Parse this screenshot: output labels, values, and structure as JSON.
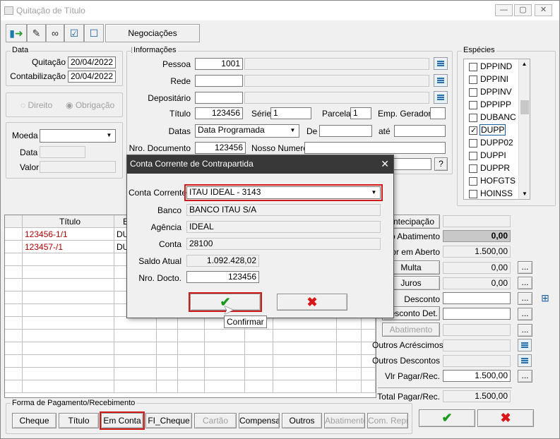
{
  "window": {
    "title": "Quitação de Título"
  },
  "toolbar": {
    "finalizadas": "Negociações Finalizadas"
  },
  "data_section": {
    "legend": "Data",
    "quitacao_label": "Quitação",
    "quitacao_value": "20/04/2022",
    "contab_label": "Contabilização",
    "contab_value": "20/04/2022"
  },
  "radio": {
    "direito": "Direito",
    "obrigacao": "Obrigação"
  },
  "moeda": {
    "moeda_label": "Moeda",
    "data_label": "Data",
    "valor_label": "Valor"
  },
  "info": {
    "legend": "Informações",
    "pessoa_label": "Pessoa",
    "pessoa_value": "1001",
    "rede_label": "Rede",
    "depositario_label": "Depositário",
    "titulo_label": "Título",
    "titulo_value": "123456",
    "serie_label": "Série",
    "serie_value": "1",
    "parcela_label": "Parcela",
    "parcela_value": "1",
    "emp_label": "Emp. Geradora",
    "datas_label": "Datas",
    "datas_value": "Data Programada",
    "de_label": "De",
    "ate_label": "até",
    "nro_doc_label": "Nro. Documento",
    "nro_doc_value": "123456",
    "nosso_label": "Nosso Numero",
    "help": "?"
  },
  "especies": {
    "legend": "Espécies",
    "items": [
      {
        "label": "DPPIND",
        "checked": false
      },
      {
        "label": "DPPINI",
        "checked": false
      },
      {
        "label": "DPPINV",
        "checked": false
      },
      {
        "label": "DPPIPP",
        "checked": false
      },
      {
        "label": "DUBANC",
        "checked": false
      },
      {
        "label": "DUPP",
        "checked": true
      },
      {
        "label": "DUPP02",
        "checked": false
      },
      {
        "label": "DUPPI",
        "checked": false
      },
      {
        "label": "DUPPR",
        "checked": false
      },
      {
        "label": "HOFGTS",
        "checked": false
      },
      {
        "label": "HOINSS",
        "checked": false
      }
    ]
  },
  "grid": {
    "header_titulo": "Título",
    "header_e": "E",
    "rows": [
      {
        "titulo": "123456-1/1",
        "col2": "DU"
      },
      {
        "titulo": "123457-/1",
        "col2": "DU"
      }
    ]
  },
  "right": {
    "antecipacao": "Antecipação",
    "abatimento_label": "lo Abatimento",
    "abatimento_value": "0,00",
    "aberto_label": "alor em Aberto",
    "aberto_value": "1.500,00",
    "multa": "Multa",
    "multa_value": "0,00",
    "juros": "Juros",
    "juros_value": "0,00",
    "desconto_label": "Desconto",
    "desconto_det": "Desconto Det.",
    "abatimento_btn": "Abatimento",
    "outros_acresc": "Outros Acréscimos",
    "outros_desc": "Outros Descontos",
    "vlr_pagar": "Vlr Pagar/Rec.",
    "vlr_pagar_value": "1.500,00",
    "total_label": "Total Pagar/Rec.",
    "total_value": "1.500,00",
    "dots": "..."
  },
  "pagamento": {
    "legend": "Forma de Pagamento/Recebimento",
    "buttons": [
      "Cheque",
      "Título",
      "Em Conta",
      "FI_Cheque",
      "Cartão",
      "Compensar",
      "Outros",
      "Abatimento",
      "Com. Repr."
    ]
  },
  "dialog": {
    "title": "Conta Corrente de Contrapartida",
    "close": "✕",
    "conta_corrente_label": "Conta Corrente",
    "conta_corrente_value": "ITAU IDEAL - 3143",
    "banco_label": "Banco",
    "banco_value": "BANCO ITAU S/A",
    "agencia_label": "Agência",
    "agencia_value": "IDEAL",
    "conta_label": "Conta",
    "conta_value": "28100",
    "saldo_label": "Saldo Atual",
    "saldo_value": "1.092.428,02",
    "nro_docto_label": "Nro. Docto.",
    "nro_docto_value": "123456",
    "tooltip": "Confirmar"
  },
  "colors": {
    "confirm": "#1a9a1a",
    "cancel": "#d81818",
    "highlight": "#d21a1a",
    "dialog_title_bg": "#383838"
  }
}
